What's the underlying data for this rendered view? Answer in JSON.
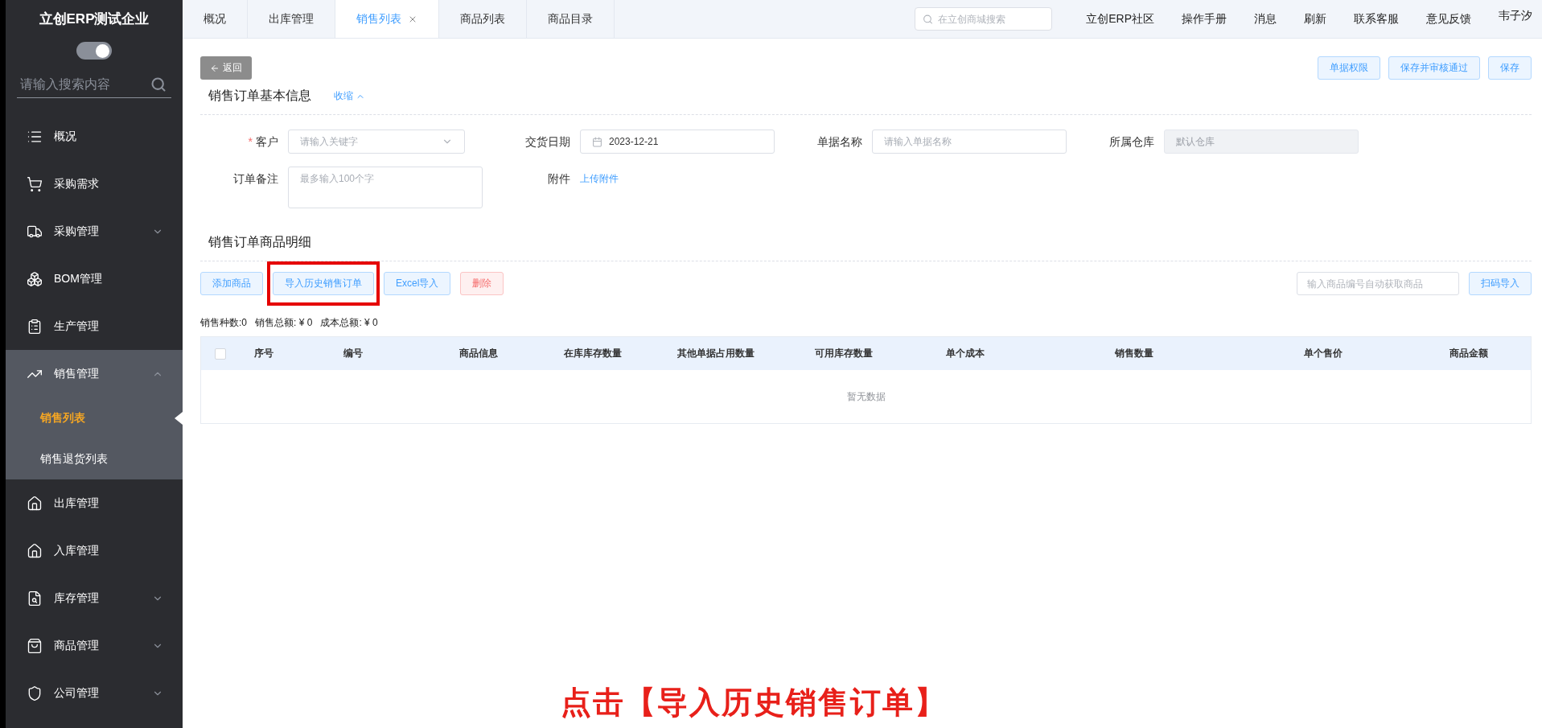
{
  "sidebar": {
    "company": "立创ERP测试企业",
    "toggle_on": true,
    "search_placeholder": "请输入搜索内容",
    "items": [
      {
        "label": "概况"
      },
      {
        "label": "采购需求"
      },
      {
        "label": "采购管理",
        "expanded": false
      },
      {
        "label": "BOM管理"
      },
      {
        "label": "生产管理"
      },
      {
        "label": "销售管理",
        "expanded": true,
        "children": [
          {
            "label": "销售列表",
            "selected": true
          },
          {
            "label": "销售退货列表",
            "selected": false
          }
        ]
      },
      {
        "label": "出库管理"
      },
      {
        "label": "入库管理"
      },
      {
        "label": "库存管理",
        "expanded": false
      },
      {
        "label": "商品管理",
        "expanded": false
      },
      {
        "label": "公司管理",
        "expanded": false
      }
    ]
  },
  "tabs": [
    {
      "label": "概况",
      "selected": false,
      "closable": false
    },
    {
      "label": "出库管理",
      "selected": false,
      "closable": false
    },
    {
      "label": "销售列表",
      "selected": true,
      "closable": true
    },
    {
      "label": "商品列表",
      "selected": false,
      "closable": false
    },
    {
      "label": "商品目录",
      "selected": false,
      "closable": false
    }
  ],
  "header": {
    "search_placeholder": "在立创商城搜索",
    "links": [
      "立创ERP社区",
      "操作手册",
      "消息",
      "刷新",
      "联系客服",
      "意见反馈"
    ],
    "user": "韦子汐"
  },
  "toolbar": {
    "back": "返回",
    "actions": [
      "单据权限",
      "保存并审核通过",
      "保存"
    ]
  },
  "basic_info": {
    "title": "销售订单基本信息",
    "collapse": {
      "label": "收缩",
      "expanded": true
    },
    "rows": [
      [
        {
          "kind": "select",
          "label": "客户",
          "required_mark": "*",
          "disabled": false,
          "placeholder": "请输入关键字"
        },
        {
          "kind": "date",
          "label": "交货日期",
          "disabled": false,
          "value": "2023-12-21"
        },
        {
          "kind": "text",
          "label": "单据名称",
          "disabled": false,
          "placeholder": "请输入单据名称"
        },
        {
          "kind": "text",
          "label": "所属仓库",
          "disabled": true,
          "placeholder": "默认仓库"
        }
      ],
      [
        {
          "kind": "textarea",
          "label": "订单备注",
          "placeholder": "最多输入100个字"
        },
        {
          "kind": "link",
          "label": "附件",
          "value": "上传附件"
        }
      ]
    ]
  },
  "detail": {
    "title": "销售订单商品明细",
    "buttons": [
      {
        "label": "添加商品",
        "kind": "default",
        "highlighted": false
      },
      {
        "label": "导入历史销售订单",
        "kind": "default",
        "highlighted": true
      },
      {
        "label": "Excel导入",
        "kind": "default",
        "highlighted": false
      },
      {
        "label": "删除",
        "kind": "danger",
        "highlighted": false
      }
    ],
    "code_placeholder": "输入商品编号自动获取商品",
    "scan_button": "扫码导入",
    "summary": [
      "销售种数:0",
      "销售总额: ¥ 0",
      "成本总额: ¥ 0"
    ],
    "table": {
      "select_all": false,
      "columns": [
        "序号",
        "编号",
        "商品信息",
        "在库库存数量",
        "其他单据占用数量",
        "可用库存数量",
        "单个成本",
        "销售数量",
        "单个售价",
        "商品金额"
      ],
      "empty": "暂无数据"
    }
  },
  "caption": "点击【导入历史销售订单】"
}
